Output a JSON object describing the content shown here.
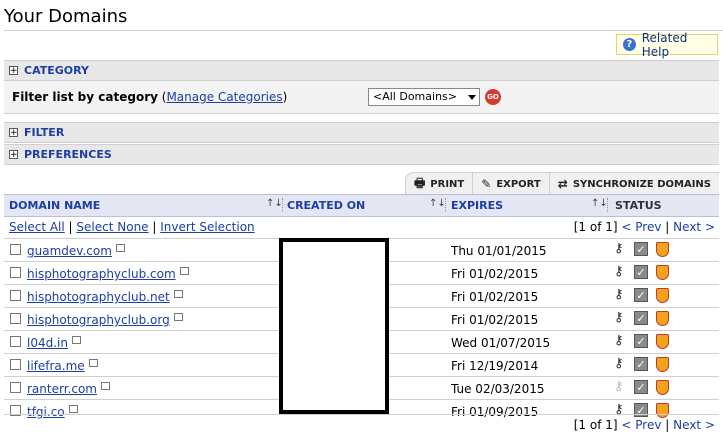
{
  "page": {
    "title": "Your Domains",
    "help_label": "Related Help",
    "help_icon": "help-icon"
  },
  "sections": {
    "category": "CATEGORY",
    "filter": "FILTER",
    "preferences": "PREFERENCES"
  },
  "filter_panel": {
    "label": "Filter list by category",
    "open_paren": "(",
    "manage_link": "Manage Categories",
    "close_paren": ")",
    "selected_category": "<All Domains>",
    "go_label": "GO"
  },
  "toolbar": {
    "print": "PRINT",
    "export": "EXPORT",
    "sync": "SYNCHRONIZE DOMAINS"
  },
  "columns": {
    "domain": "DOMAIN NAME",
    "created": "CREATED ON",
    "expires": "EXPIRES",
    "status": "STATUS",
    "sort_glyph": "↑↓"
  },
  "selection": {
    "select_all": "Select All",
    "select_none": "Select None",
    "invert": "Invert Selection",
    "sep": "|"
  },
  "pager": {
    "position": "[1 of 1]",
    "prev": "< Prev",
    "sep": "|",
    "next": "Next >"
  },
  "domains": [
    {
      "name": "guamdev.com",
      "expires": "Thu 01/01/2015",
      "lock_faded": false
    },
    {
      "name": "hisphotographyclub.com",
      "expires": "Fri 01/02/2015",
      "lock_faded": false
    },
    {
      "name": "hisphotographyclub.net",
      "expires": "Fri 01/02/2015",
      "lock_faded": false
    },
    {
      "name": "hisphotographyclub.org",
      "expires": "Fri 01/02/2015",
      "lock_faded": false
    },
    {
      "name": "l04d.in",
      "expires": "Wed 01/07/2015",
      "lock_faded": false
    },
    {
      "name": "lifefra.me",
      "expires": "Fri 12/19/2014",
      "lock_faded": false
    },
    {
      "name": "ranterr.com",
      "expires": "Tue 02/03/2015",
      "lock_faded": true
    },
    {
      "name": "tfgi.co",
      "expires": "Fri 01/09/2015",
      "lock_faded": false
    }
  ],
  "colors": {
    "link": "#1c3ea5",
    "header_bg": "#e4e6f4",
    "go_button": "#d73a2c"
  }
}
